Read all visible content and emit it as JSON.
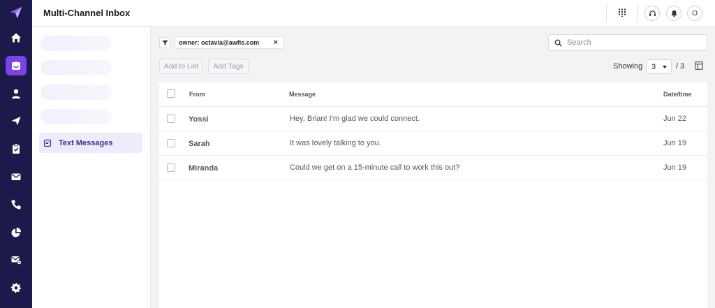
{
  "app": {
    "title": "Multi-Channel Inbox"
  },
  "theme": {
    "rail_bg": "#1c1a4a",
    "accent": "#7b43e6",
    "active_item_bg": "#efebfb"
  },
  "rail": {
    "logo_icon": "paper-plane-logo-icon",
    "items": [
      {
        "icon": "home-icon",
        "active": false
      },
      {
        "icon": "inbox-icon",
        "active": true
      },
      {
        "icon": "user-icon",
        "active": false
      },
      {
        "icon": "send-icon",
        "active": false
      },
      {
        "icon": "clipboard-check-icon",
        "active": false
      },
      {
        "icon": "mail-icon",
        "active": false
      },
      {
        "icon": "phone-icon",
        "active": false
      },
      {
        "icon": "pie-chart-icon",
        "active": false
      },
      {
        "icon": "mail-settings-icon",
        "active": false
      },
      {
        "icon": "gear-icon",
        "active": false
      }
    ]
  },
  "header": {
    "avatar_initial": "O",
    "icons": [
      "apps-grid-icon",
      "headset-icon",
      "bell-icon"
    ]
  },
  "sidepanel": {
    "active_item": {
      "label": "Text Messages",
      "icon": "message-icon"
    }
  },
  "filters": {
    "chip_label": "owner: octavia@awfis.com",
    "remove_symbol": "×"
  },
  "toolbar": {
    "add_to_list": "Add to List",
    "add_tags": "Add Tags"
  },
  "search": {
    "placeholder": "Search",
    "value": ""
  },
  "pagination": {
    "showing_label": "Showing",
    "page_size": "3",
    "total": "/ 3"
  },
  "table": {
    "headers": {
      "from": "From",
      "message": "Message",
      "date": "Date/time"
    },
    "rows": [
      {
        "from": "Yossi",
        "message": "Hey, Brian! I'm glad we could connect.",
        "date": "Jun 22"
      },
      {
        "from": "Sarah",
        "message": "It was lovely talking to you.",
        "date": "Jun 19"
      },
      {
        "from": "Miranda",
        "message": "Could we get on a 15-minute call to work this out?",
        "date": "Jun 19"
      }
    ]
  }
}
